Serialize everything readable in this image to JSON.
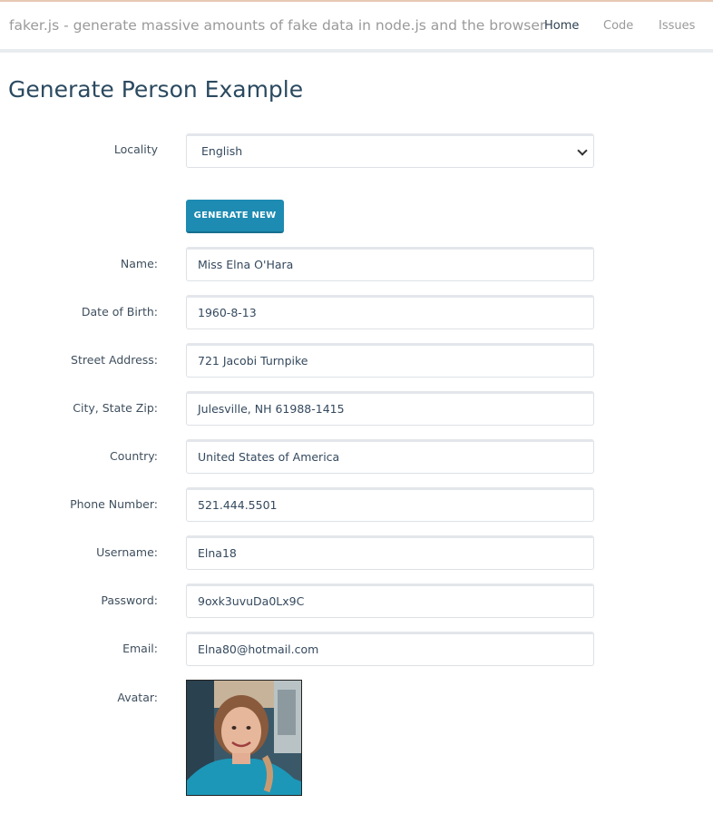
{
  "navbar": {
    "brand": "faker.js - generate massive amounts of fake data in node.js and the browser",
    "links": [
      {
        "label": "Home",
        "active": true
      },
      {
        "label": "Code",
        "active": false
      },
      {
        "label": "Issues",
        "active": false
      }
    ]
  },
  "page": {
    "title": "Generate Person Example"
  },
  "locality": {
    "label": "Locality",
    "selected": "English"
  },
  "generate_button": "GENERATE NEW",
  "fields": [
    {
      "label": "Name:",
      "value": "Miss Elna O'Hara"
    },
    {
      "label": "Date of Birth:",
      "value": "1960-8-13"
    },
    {
      "label": "Street Address:",
      "value": "721 Jacobi Turnpike"
    },
    {
      "label": "City, State Zip:",
      "value": "Julesville, NH 61988-1415"
    },
    {
      "label": "Country:",
      "value": "United States of America"
    },
    {
      "label": "Phone Number:",
      "value": "521.444.5501"
    },
    {
      "label": "Username:",
      "value": "Elna18"
    },
    {
      "label": "Password:",
      "value": "9oxk3uvuDa0Lx9C"
    },
    {
      "label": "Email:",
      "value": "Elna80@hotmail.com"
    }
  ],
  "avatar": {
    "label": "Avatar:"
  },
  "colors": {
    "accent": "#1e8bb2",
    "title": "#2b4a60"
  }
}
